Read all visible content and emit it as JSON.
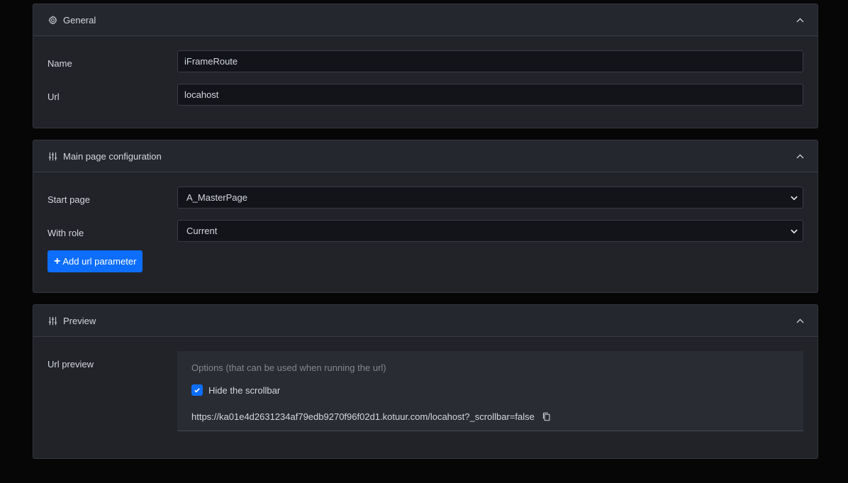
{
  "general": {
    "title": "General",
    "icon": "gear-icon",
    "fields": {
      "name_label": "Name",
      "name_value": "iFrameRoute",
      "url_label": "Url",
      "url_value": "locahost"
    }
  },
  "main_page": {
    "title": "Main page configuration",
    "icon": "sliders-icon",
    "start_page_label": "Start page",
    "start_page_value": "A_MasterPage",
    "with_role_label": "With role",
    "with_role_value": "Current",
    "add_param_label": "Add url parameter"
  },
  "preview": {
    "title": "Preview",
    "icon": "sliders-icon",
    "url_preview_label": "Url preview",
    "options_label": "Options (that can be used when running the url)",
    "hide_scrollbar_label": "Hide the scrollbar",
    "hide_scrollbar_checked": true,
    "url": "https://ka01e4d2631234af79edb9270f96f02d1.kotuur.com/locahost?_scrollbar=false"
  },
  "colors": {
    "page_bg": "#060607",
    "panel_bg": "#212329",
    "accent": "#0d6efd",
    "input_bg": "#12141a"
  }
}
